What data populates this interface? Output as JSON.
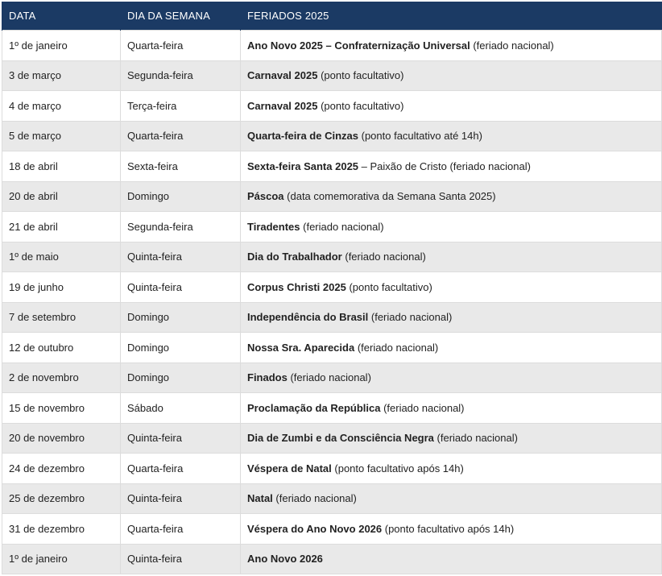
{
  "header": {
    "col_date": "DATA",
    "col_weekday": "DIA DA SEMANA",
    "col_holiday": "FERIADOS 2025"
  },
  "rows": [
    {
      "date": "1º de janeiro",
      "weekday": "Quarta-feira",
      "name": "Ano Novo 2025 – Confraternização Universal",
      "note": " (feriado nacional)"
    },
    {
      "date": "3 de março",
      "weekday": "Segunda-feira",
      "name": "Carnaval 2025",
      "note": " (ponto facultativo)"
    },
    {
      "date": "4 de março",
      "weekday": "Terça-feira",
      "name": "Carnaval 2025",
      "note": " (ponto facultativo)"
    },
    {
      "date": "5 de março",
      "weekday": "Quarta-feira",
      "name": "Quarta-feira de Cinzas",
      "note": " (ponto facultativo até 14h)"
    },
    {
      "date": "18 de abril",
      "weekday": "Sexta-feira",
      "name": "Sexta-feira Santa 2025",
      "note": " – Paixão de Cristo (feriado nacional)"
    },
    {
      "date": "20 de abril",
      "weekday": "Domingo",
      "name": "Páscoa",
      "note": " (data comemorativa da Semana Santa 2025)"
    },
    {
      "date": "21 de abril",
      "weekday": "Segunda-feira",
      "name": "Tiradentes",
      "note": " (feriado nacional)"
    },
    {
      "date": "1º de maio",
      "weekday": "Quinta-feira",
      "name": "Dia do Trabalhador",
      "note": " (feriado nacional)"
    },
    {
      "date": "19 de junho",
      "weekday": "Quinta-feira",
      "name": "Corpus Christi 2025",
      "note": " (ponto facultativo)"
    },
    {
      "date": "7 de setembro",
      "weekday": "Domingo",
      "name": "Independência do Brasil",
      "note": " (feriado nacional)"
    },
    {
      "date": "12 de outubro",
      "weekday": "Domingo",
      "name": "Nossa Sra. Aparecida",
      "note": " (feriado nacional)"
    },
    {
      "date": "2 de novembro",
      "weekday": "Domingo",
      "name": "Finados",
      "note": " (feriado nacional)"
    },
    {
      "date": "15 de novembro",
      "weekday": "Sábado",
      "name": "Proclamação da República",
      "note": " (feriado nacional)"
    },
    {
      "date": "20 de novembro",
      "weekday": "Quinta-feira",
      "name": "Dia de Zumbi e da Consciência Negra",
      "note": " (feriado nacional)"
    },
    {
      "date": "24 de dezembro",
      "weekday": "Quarta-feira",
      "name": "Véspera de Natal",
      "note": " (ponto facultativo após 14h)"
    },
    {
      "date": "25 de dezembro",
      "weekday": "Quinta-feira",
      "name": "Natal",
      "note": " (feriado nacional)"
    },
    {
      "date": "31 de dezembro",
      "weekday": "Quarta-feira",
      "name": "Véspera do Ano Novo 2026",
      "note": " (ponto facultativo após 14h)"
    },
    {
      "date": "1º de janeiro",
      "weekday": "Quinta-feira",
      "name": "Ano Novo 2026",
      "note": ""
    }
  ],
  "colors": {
    "header_bg": "#1b3a64",
    "row_alt_bg": "#e9e9e9"
  }
}
